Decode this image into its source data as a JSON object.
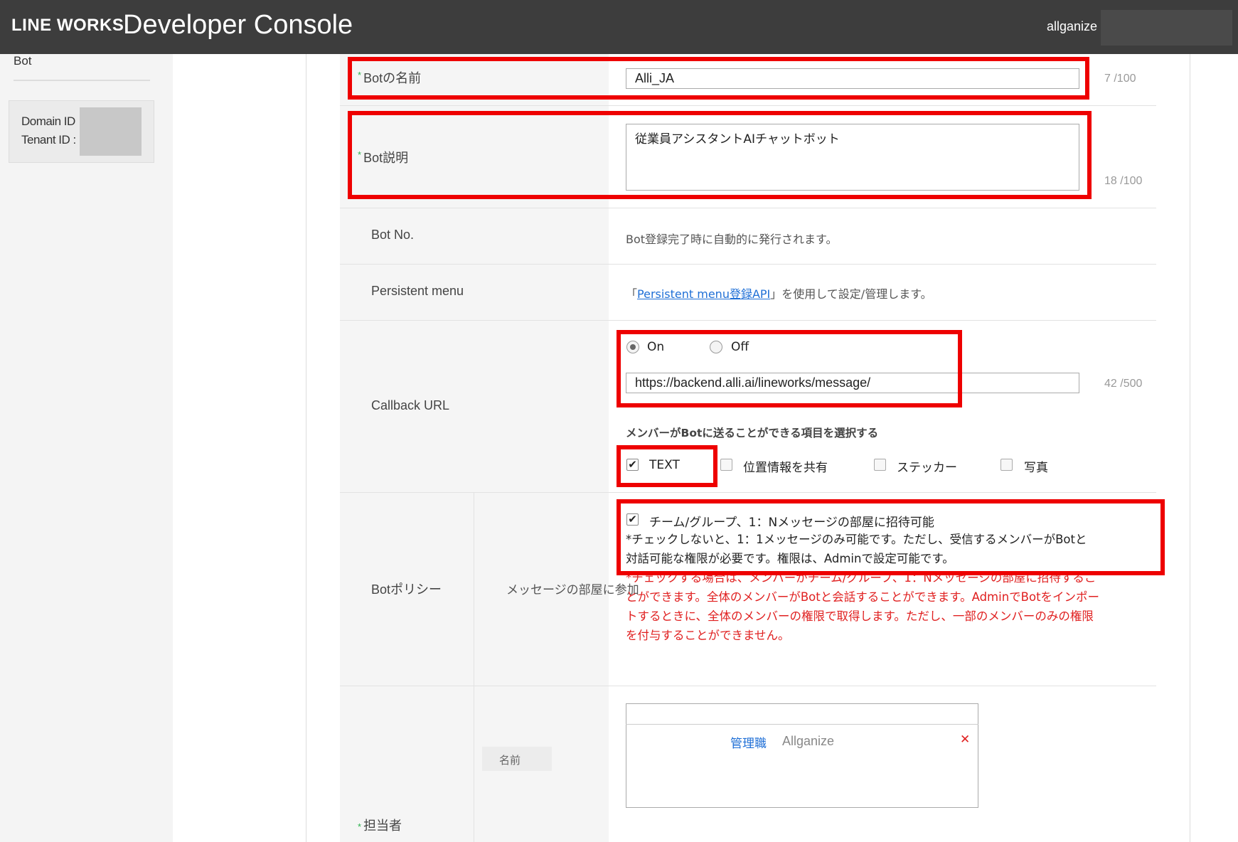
{
  "header": {
    "logo": "LINE WORKS",
    "title": "Developer Console",
    "user": "allganize"
  },
  "sidebar": {
    "section": "Bot",
    "domain_id_label": "Domain ID",
    "tenant_id_label": "Tenant ID :"
  },
  "form": {
    "bot_name": {
      "label": "Botの名前",
      "value": "Alli_JA",
      "counter": "7 /100"
    },
    "bot_desc": {
      "label": "Bot説明",
      "value": "従業員アシスタントAIチャットボット",
      "counter": "18 /100"
    },
    "bot_no": {
      "label": "Bot No.",
      "text": "Bot登録完了時に自動的に発行されます。"
    },
    "persistent_menu": {
      "label": "Persistent menu",
      "prefix": "「",
      "link": "Persistent menu登録API",
      "suffix": "」を使用して設定/管理します。"
    },
    "callback": {
      "label": "Callback URL",
      "on_label": "On",
      "off_label": "Off",
      "url": "https://backend.alli.ai/lineworks/message/",
      "counter": "42 /500",
      "select_title": "メンバーがBotに送ることができる項目を選択する",
      "options": [
        {
          "label": "TEXT",
          "checked": true
        },
        {
          "label": "位置情報を共有",
          "checked": false
        },
        {
          "label": "ステッカー",
          "checked": false
        },
        {
          "label": "写真",
          "checked": false
        }
      ]
    },
    "policy": {
      "label": "Botポリシー",
      "sub_label": "メッセージの部屋に参加",
      "checkbox_label": "チーム/グループ、1：Nメッセージの部屋に招待可能",
      "note_line1": "*チェックしないと、1：1メッセージのみ可能です。ただし、受信するメンバーがBotと",
      "note_line2": "対話可能な権限が必要です。権限は、Adminで設定可能です。",
      "warn_line1": "*チェックする場合は、メンバーがチーム/グループ、1：Nメッセージの部屋に招待するこ",
      "warn_line2": "とができます。全体のメンバーがBotと会話することができます。AdminでBotをインポー",
      "warn_line3": "トするときに、全体のメンバーの権限で取得します。ただし、一部のメンバーのみの権限",
      "warn_line4": "を付与することができません。"
    },
    "manager": {
      "label": "担当者",
      "sub_label": "名前",
      "tag_role": "管理職",
      "tag_org": "Allganize",
      "remove_glyph": "✕"
    }
  },
  "colors": {
    "header_bg": "#3d3d3d",
    "highlight": "#ee0000",
    "link": "#1f6fd6",
    "required": "#2bb24c",
    "warning": "#e02020"
  }
}
